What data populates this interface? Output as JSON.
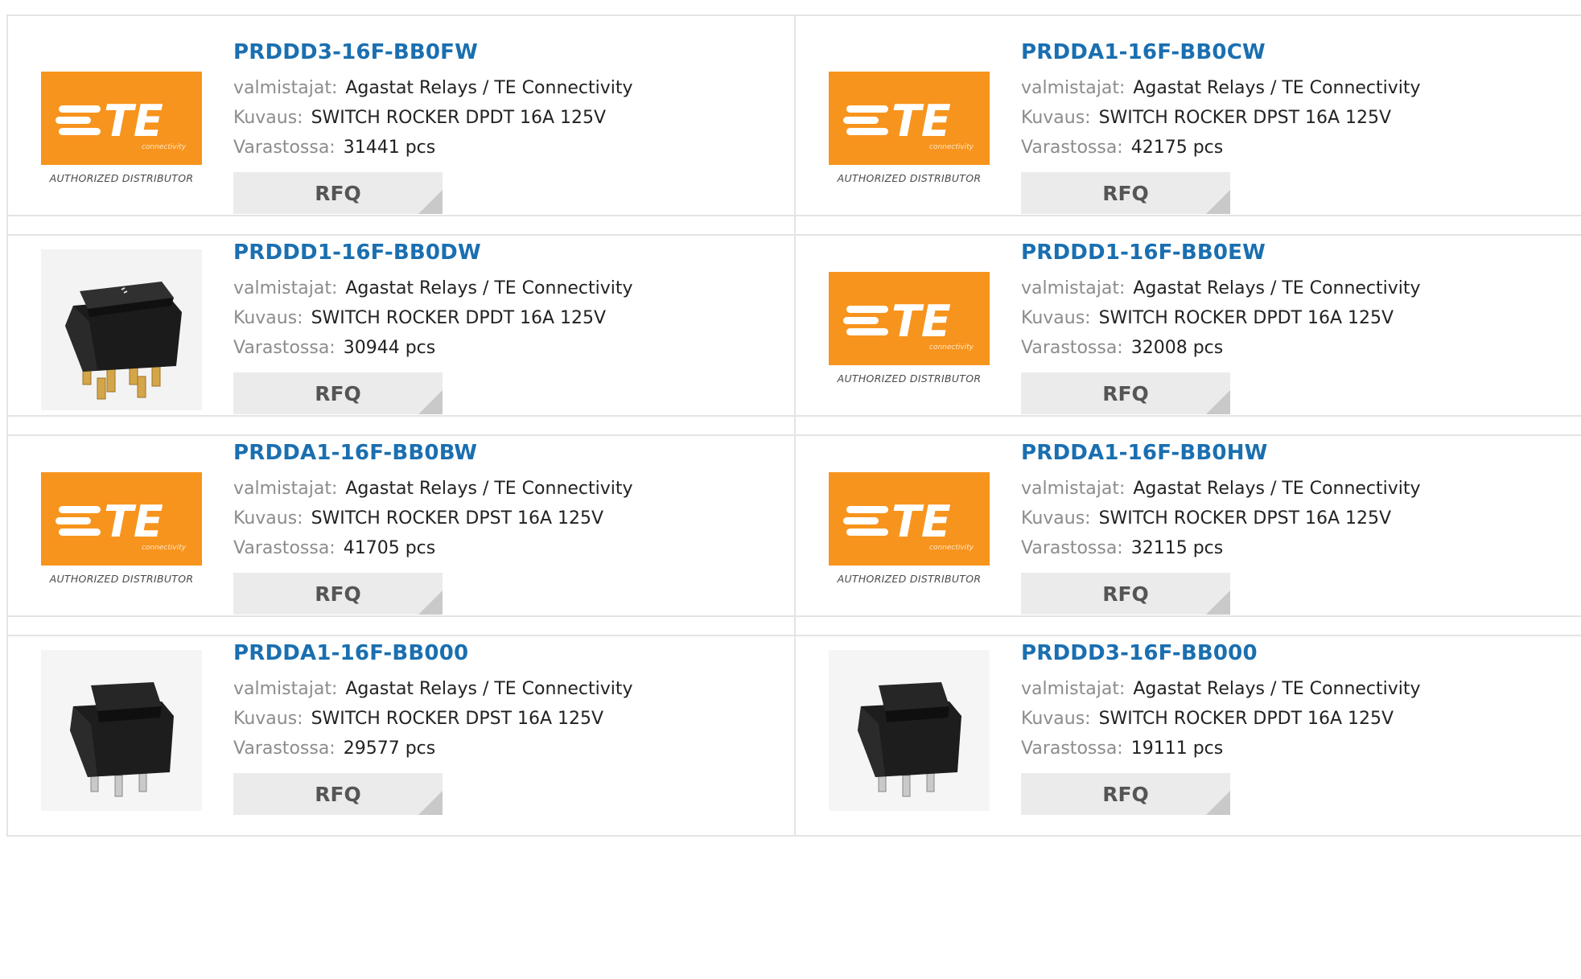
{
  "labels": {
    "manufacturer": "valmistajat:",
    "description": "Kuvaus:",
    "stock": "Varastossa:",
    "rfq": "RFQ"
  },
  "logo": {
    "brand": "TE",
    "sub": "connectivity",
    "authorized": "AUTHORIZED DISTRIBUTOR",
    "color": "#f7941d"
  },
  "products": [
    {
      "part": "PRDDD3-16F-BB0FW",
      "manufacturer": "Agastat Relays / TE Connectivity",
      "description": "SWITCH ROCKER DPDT 16A 125V",
      "stock": "31441 pcs",
      "image": "te-logo"
    },
    {
      "part": "PRDDA1-16F-BB0CW",
      "manufacturer": "Agastat Relays / TE Connectivity",
      "description": "SWITCH ROCKER DPST 16A 125V",
      "stock": "42175 pcs",
      "image": "te-logo"
    },
    {
      "part": "PRDDD1-16F-BB0DW",
      "manufacturer": "Agastat Relays / TE Connectivity",
      "description": "SWITCH ROCKER DPDT 16A 125V",
      "stock": "30944 pcs",
      "image": "wide-rocker-switch"
    },
    {
      "part": "PRDDD1-16F-BB0EW",
      "manufacturer": "Agastat Relays / TE Connectivity",
      "description": "SWITCH ROCKER DPDT 16A 125V",
      "stock": "32008 pcs",
      "image": "te-logo"
    },
    {
      "part": "PRDDA1-16F-BB0BW",
      "manufacturer": "Agastat Relays / TE Connectivity",
      "description": "SWITCH ROCKER DPST 16A 125V",
      "stock": "41705 pcs",
      "image": "te-logo"
    },
    {
      "part": "PRDDA1-16F-BB0HW",
      "manufacturer": "Agastat Relays / TE Connectivity",
      "description": "SWITCH ROCKER DPST 16A 125V",
      "stock": "32115 pcs",
      "image": "te-logo"
    },
    {
      "part": "PRDDA1-16F-BB000",
      "manufacturer": "Agastat Relays / TE Connectivity",
      "description": "SWITCH ROCKER DPST 16A 125V",
      "stock": "29577 pcs",
      "image": "square-rocker-switch"
    },
    {
      "part": "PRDDD3-16F-BB000",
      "manufacturer": "Agastat Relays / TE Connectivity",
      "description": "SWITCH ROCKER DPDT 16A 125V",
      "stock": "19111 pcs",
      "image": "square-rocker-switch"
    }
  ]
}
